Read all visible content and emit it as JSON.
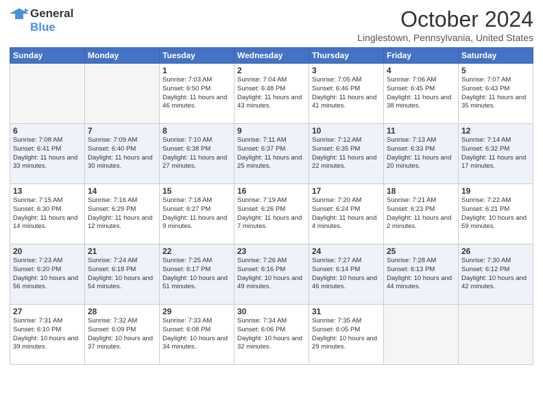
{
  "header": {
    "logo_general": "General",
    "logo_blue": "Blue",
    "month_title": "October 2024",
    "location": "Linglestown, Pennsylvania, United States"
  },
  "days_of_week": [
    "Sunday",
    "Monday",
    "Tuesday",
    "Wednesday",
    "Thursday",
    "Friday",
    "Saturday"
  ],
  "weeks": [
    [
      {
        "day": "",
        "info": ""
      },
      {
        "day": "",
        "info": ""
      },
      {
        "day": "1",
        "info": "Sunrise: 7:03 AM\nSunset: 6:50 PM\nDaylight: 11 hours and 46 minutes."
      },
      {
        "day": "2",
        "info": "Sunrise: 7:04 AM\nSunset: 6:48 PM\nDaylight: 11 hours and 43 minutes."
      },
      {
        "day": "3",
        "info": "Sunrise: 7:05 AM\nSunset: 6:46 PM\nDaylight: 11 hours and 41 minutes."
      },
      {
        "day": "4",
        "info": "Sunrise: 7:06 AM\nSunset: 6:45 PM\nDaylight: 11 hours and 38 minutes."
      },
      {
        "day": "5",
        "info": "Sunrise: 7:07 AM\nSunset: 6:43 PM\nDaylight: 11 hours and 35 minutes."
      }
    ],
    [
      {
        "day": "6",
        "info": "Sunrise: 7:08 AM\nSunset: 6:41 PM\nDaylight: 11 hours and 33 minutes."
      },
      {
        "day": "7",
        "info": "Sunrise: 7:09 AM\nSunset: 6:40 PM\nDaylight: 11 hours and 30 minutes."
      },
      {
        "day": "8",
        "info": "Sunrise: 7:10 AM\nSunset: 6:38 PM\nDaylight: 11 hours and 27 minutes."
      },
      {
        "day": "9",
        "info": "Sunrise: 7:11 AM\nSunset: 6:37 PM\nDaylight: 11 hours and 25 minutes."
      },
      {
        "day": "10",
        "info": "Sunrise: 7:12 AM\nSunset: 6:35 PM\nDaylight: 11 hours and 22 minutes."
      },
      {
        "day": "11",
        "info": "Sunrise: 7:13 AM\nSunset: 6:33 PM\nDaylight: 11 hours and 20 minutes."
      },
      {
        "day": "12",
        "info": "Sunrise: 7:14 AM\nSunset: 6:32 PM\nDaylight: 11 hours and 17 minutes."
      }
    ],
    [
      {
        "day": "13",
        "info": "Sunrise: 7:15 AM\nSunset: 6:30 PM\nDaylight: 11 hours and 14 minutes."
      },
      {
        "day": "14",
        "info": "Sunrise: 7:16 AM\nSunset: 6:29 PM\nDaylight: 11 hours and 12 minutes."
      },
      {
        "day": "15",
        "info": "Sunrise: 7:18 AM\nSunset: 6:27 PM\nDaylight: 11 hours and 9 minutes."
      },
      {
        "day": "16",
        "info": "Sunrise: 7:19 AM\nSunset: 6:26 PM\nDaylight: 11 hours and 7 minutes."
      },
      {
        "day": "17",
        "info": "Sunrise: 7:20 AM\nSunset: 6:24 PM\nDaylight: 11 hours and 4 minutes."
      },
      {
        "day": "18",
        "info": "Sunrise: 7:21 AM\nSunset: 6:23 PM\nDaylight: 11 hours and 2 minutes."
      },
      {
        "day": "19",
        "info": "Sunrise: 7:22 AM\nSunset: 6:21 PM\nDaylight: 10 hours and 59 minutes."
      }
    ],
    [
      {
        "day": "20",
        "info": "Sunrise: 7:23 AM\nSunset: 6:20 PM\nDaylight: 10 hours and 56 minutes."
      },
      {
        "day": "21",
        "info": "Sunrise: 7:24 AM\nSunset: 6:18 PM\nDaylight: 10 hours and 54 minutes."
      },
      {
        "day": "22",
        "info": "Sunrise: 7:25 AM\nSunset: 6:17 PM\nDaylight: 10 hours and 51 minutes."
      },
      {
        "day": "23",
        "info": "Sunrise: 7:26 AM\nSunset: 6:16 PM\nDaylight: 10 hours and 49 minutes."
      },
      {
        "day": "24",
        "info": "Sunrise: 7:27 AM\nSunset: 6:14 PM\nDaylight: 10 hours and 46 minutes."
      },
      {
        "day": "25",
        "info": "Sunrise: 7:28 AM\nSunset: 6:13 PM\nDaylight: 10 hours and 44 minutes."
      },
      {
        "day": "26",
        "info": "Sunrise: 7:30 AM\nSunset: 6:12 PM\nDaylight: 10 hours and 42 minutes."
      }
    ],
    [
      {
        "day": "27",
        "info": "Sunrise: 7:31 AM\nSunset: 6:10 PM\nDaylight: 10 hours and 39 minutes."
      },
      {
        "day": "28",
        "info": "Sunrise: 7:32 AM\nSunset: 6:09 PM\nDaylight: 10 hours and 37 minutes."
      },
      {
        "day": "29",
        "info": "Sunrise: 7:33 AM\nSunset: 6:08 PM\nDaylight: 10 hours and 34 minutes."
      },
      {
        "day": "30",
        "info": "Sunrise: 7:34 AM\nSunset: 6:06 PM\nDaylight: 10 hours and 32 minutes."
      },
      {
        "day": "31",
        "info": "Sunrise: 7:35 AM\nSunset: 6:05 PM\nDaylight: 10 hours and 29 minutes."
      },
      {
        "day": "",
        "info": ""
      },
      {
        "day": "",
        "info": ""
      }
    ]
  ]
}
